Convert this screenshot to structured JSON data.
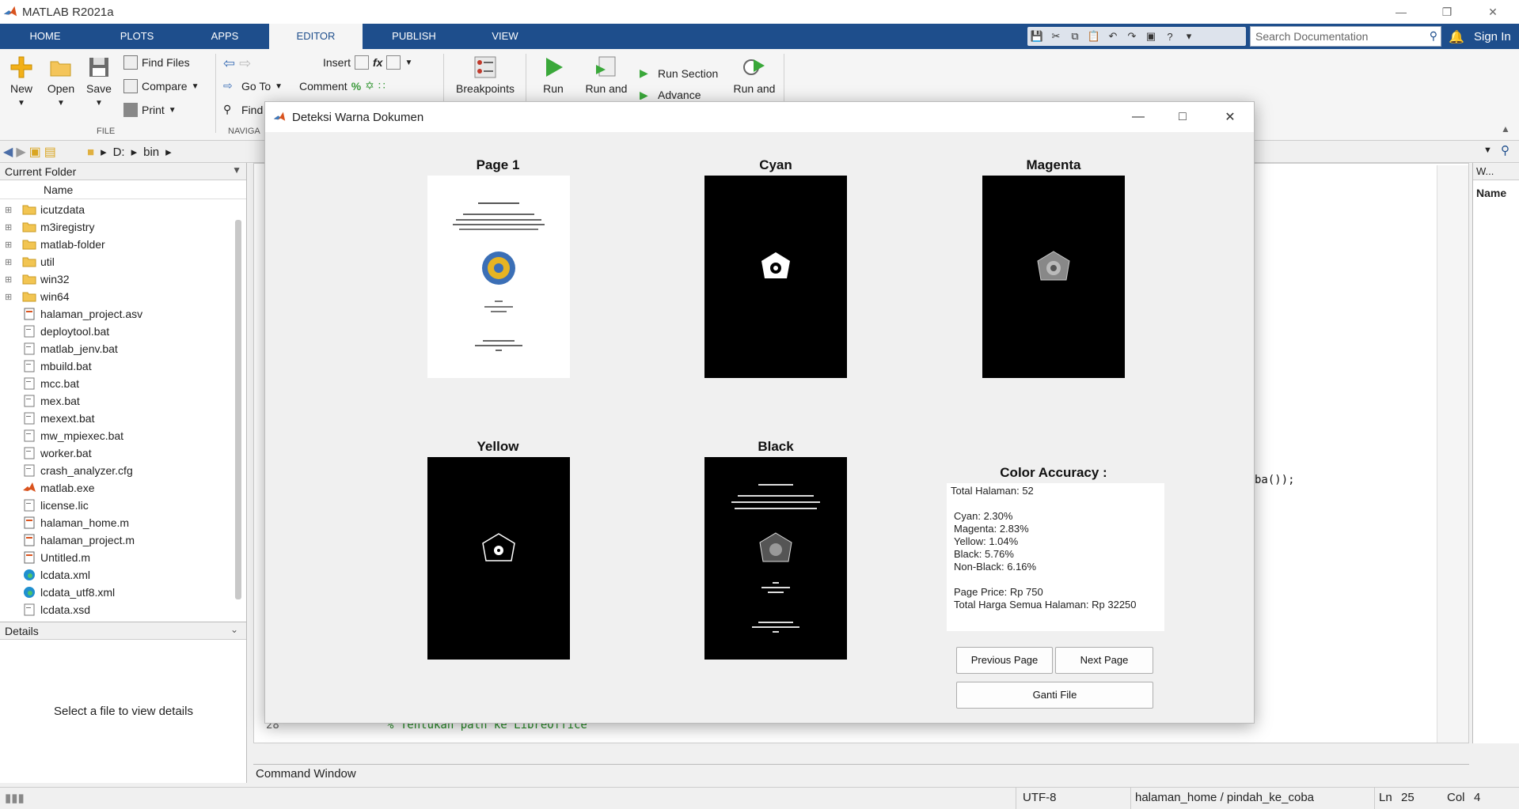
{
  "app": {
    "title": "MATLAB R2021a"
  },
  "tabs": [
    "HOME",
    "PLOTS",
    "APPS",
    "EDITOR",
    "PUBLISH",
    "VIEW"
  ],
  "search": {
    "placeholder": "Search Documentation"
  },
  "signin": "Sign In",
  "ribbon": {
    "new": "New",
    "open": "Open",
    "save": "Save",
    "find_files": "Find Files",
    "compare": "Compare",
    "print": "Print",
    "file_group": "FILE",
    "go_to": "Go To",
    "find": "Find",
    "navigate_group": "NAVIGA",
    "insert": "Insert",
    "comment": "Comment",
    "breakpoints": "Breakpoints",
    "run": "Run",
    "run_and_advance": "Run and",
    "run_section": "Run Section",
    "advance": "Advance",
    "run_and_time": "Run and"
  },
  "address": {
    "drive": "D:",
    "folder": "bin"
  },
  "current_folder": {
    "title": "Current Folder",
    "column": "Name",
    "folders": [
      "icutzdata",
      "m3iregistry",
      "matlab-folder",
      "util",
      "win32",
      "win64"
    ],
    "files": [
      "halaman_project.asv",
      "deploytool.bat",
      "matlab_jenv.bat",
      "mbuild.bat",
      "mcc.bat",
      "mex.bat",
      "mexext.bat",
      "mw_mpiexec.bat",
      "worker.bat",
      "crash_analyzer.cfg",
      "matlab.exe",
      "license.lic",
      "halaman_home.m",
      "halaman_project.m",
      "Untitled.m",
      "lcdata.xml",
      "lcdata_utf8.xml",
      "lcdata.xsd"
    ]
  },
  "details": {
    "title": "Details",
    "text": "Select a file to view details"
  },
  "editor": {
    "line_no": "28",
    "comment": "% Tentukan path ke LibreOffice",
    "code_tail": "ba());",
    "right_label": "W...",
    "right_col": "Name"
  },
  "command_window": "Command Window",
  "status": {
    "encoding": "UTF-8",
    "func": "halaman_home / pindah_ke_coba",
    "ln_label": "Ln",
    "ln": "25",
    "col_label": "Col",
    "col": "4"
  },
  "dialog": {
    "title": "Deteksi Warna Dokumen",
    "page_title": "Page 1",
    "cyan_title": "Cyan",
    "magenta_title": "Magenta",
    "yellow_title": "Yellow",
    "black_title": "Black",
    "accuracy_title": "Color Accuracy :",
    "accuracy_lines": [
      "Total Halaman: 52",
      "",
      "Cyan: 2.30%",
      "Magenta: 2.83%",
      "Yellow: 1.04%",
      "Black: 5.76%",
      "Non-Black: 6.16%",
      "",
      "Page Price: Rp 750",
      "Total Harga Semua Halaman: Rp 32250"
    ],
    "prev_button": "Previous Page",
    "next_button": "Next Page",
    "change_file_button": "Ganti File"
  },
  "colors": {
    "ribbon_tab_bg": "#1e4e8c",
    "matlab_orange": "#d9531e"
  }
}
